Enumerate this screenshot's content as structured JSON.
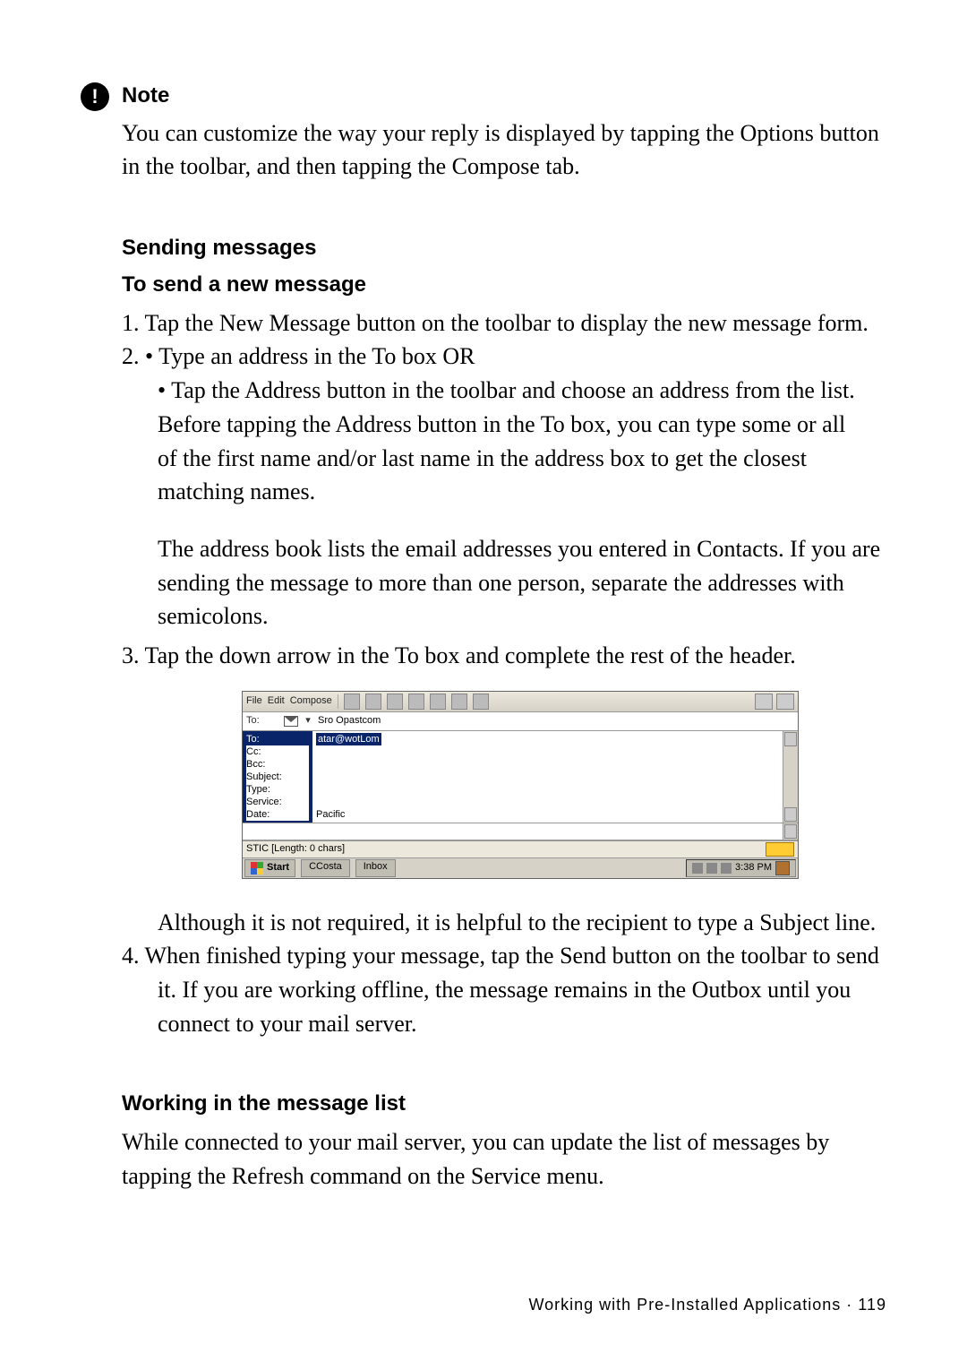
{
  "note": {
    "icon_char": "!",
    "heading": "Note",
    "body": "You can customize the way your reply is displayed by tapping the Options button in the toolbar, and then tapping the Compose tab."
  },
  "sending": {
    "heading": "Sending messages",
    "subheading": "To send a new message",
    "step1": "1. Tap the New Message button on the toolbar to display the new message form.",
    "step2_intro": "2. • Type an address in the To box OR",
    "step2_b1": "• Tap the Address button in the toolbar and choose an address from the list.",
    "step2_b2": "Before tapping the Address button in the To box, you can type some or all",
    "step2_b3": "of the first name and/or last name in the address box to get the closest",
    "step2_b4": "matching names.",
    "step2_p2a": "The address book lists the email addresses you entered in Contacts. If you are",
    "step2_p2b": "sending the message to more than one person, separate the addresses with",
    "step2_p2c": "semicolons.",
    "step3": "3. Tap the down arrow in the To box and complete the rest of the header.",
    "after1": "Although it is not required, it is helpful to the recipient to type a Subject line.",
    "step4a": "4. When finished typing your message, tap the Send button on the toolbar to send",
    "step4b": "it. If you are working offline, the message remains in the Outbox until you",
    "step4c": "connect to your mail server."
  },
  "working": {
    "heading": "Working in the message list",
    "body": "While connected to your mail server, you can update the list of messages by tapping the Refresh command on the Service menu."
  },
  "footer": {
    "label": "Working with Pre-Installed Applications · 119"
  },
  "app": {
    "menu_file": "File",
    "menu_edit": "Edit",
    "menu_compose": "Compose",
    "to_label": "To:",
    "to_value": "Sro Opastcom",
    "hdr_to": "To:",
    "hdr_to_val": "atar@wotLom",
    "hdr_cc": "Cc:",
    "hdr_bcc": "Bcc:",
    "hdr_subject": "Subject:",
    "hdr_type": "Type:",
    "hdr_service": "Service:",
    "hdr_date": "Date:",
    "hdr_date_val": "Pacific",
    "status": "STIC [Length: 0 chars]",
    "start": "Start",
    "task1": "CCosta",
    "task2": "Inbox",
    "time": "3:38 PM"
  }
}
